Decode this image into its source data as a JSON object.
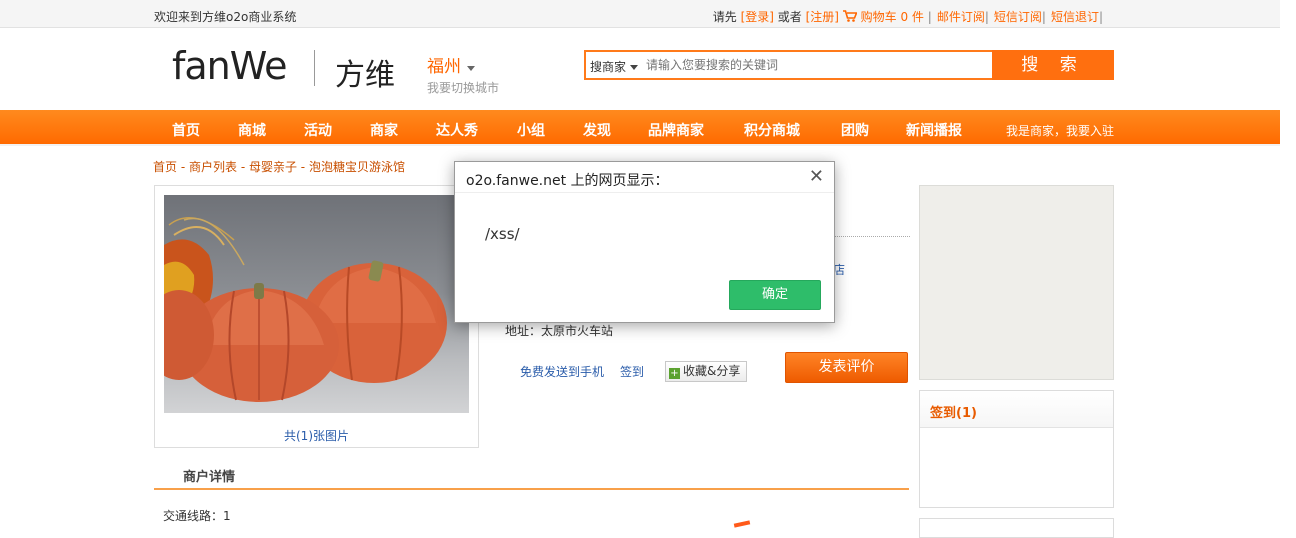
{
  "topbar": {
    "welcome": "欢迎来到方维o2o商业系统",
    "please": "请先",
    "login": "[登录]",
    "or": "或者",
    "register": "[注册]",
    "cart_label": "购物车",
    "cart_count": "0 件",
    "email_sub": "邮件订阅",
    "sms_sub": "短信订阅",
    "sms_unsub": "短信退订"
  },
  "header": {
    "logo_text": "fanWe",
    "logo_cn": "方维",
    "city": "福州",
    "city_sub": "我要切换城市",
    "search_type": "搜商家",
    "search_placeholder": "请输入您要搜索的关键词",
    "search_button": "搜 索"
  },
  "nav": {
    "items": [
      "首页",
      "商城",
      "活动",
      "商家",
      "达人秀",
      "小组",
      "发现",
      "品牌商家",
      "积分商城",
      "团购",
      "新闻播报"
    ],
    "right": "我是商家，我要入驻"
  },
  "breadcrumb": {
    "items": [
      "首页",
      "商户列表",
      "母婴亲子",
      "泡泡糖宝贝游泳馆"
    ],
    "sep": " - "
  },
  "photo": {
    "caption": "共(1)张图片",
    "icon": "pumpkin-photo"
  },
  "shop": {
    "name_suffix": "店",
    "address": "地址：太原市火车站",
    "send_phone": "免费发送到手机",
    "checkin": "签到",
    "collect_share": "收藏&分享",
    "review_button": "发表评价"
  },
  "details": {
    "tab": "商户详情",
    "traffic": "交通线路：1"
  },
  "sidebar": {
    "sign_title": "签到(1)"
  },
  "dialog": {
    "title": "o2o.fanwe.net 上的网页显示：",
    "message": "/xss/",
    "ok": "确定"
  },
  "colors": {
    "accent": "#ff6600",
    "nav": "#ff7a10",
    "link": "#2a5caa",
    "ok_button": "#2ebd6a"
  }
}
